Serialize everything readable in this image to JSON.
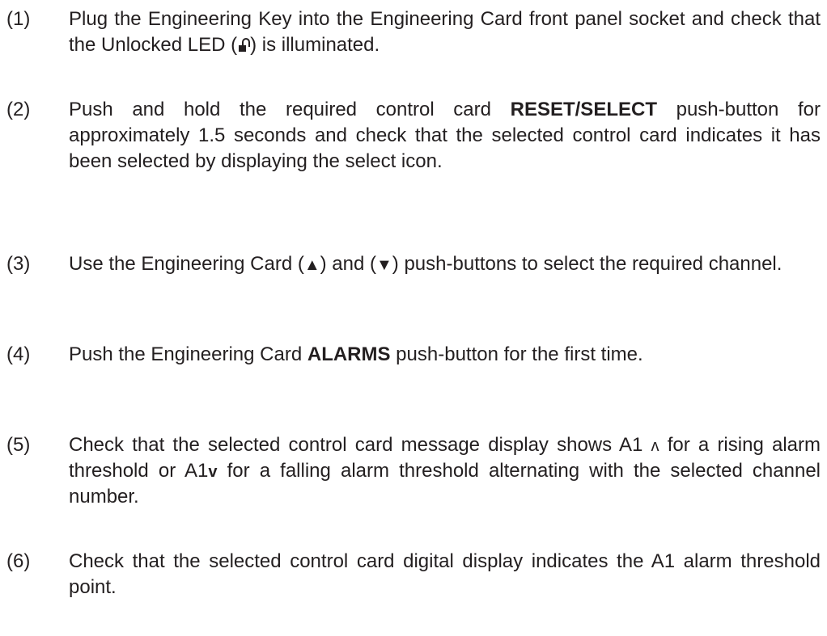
{
  "steps": [
    {
      "number": "(1)",
      "before": "Plug the Engineering Key into the Engineering Card front panel socket and check that the Unlocked LED (",
      "icon": "unlocked-padlock-icon",
      "after": ") is illuminated."
    },
    {
      "number": "(2)",
      "before": "Push and hold the required control card ",
      "bold": "RESET/SELECT",
      "after": " push-button for approximately 1.5 seconds and check that the selected control card indicates it has been selected by displaying the select icon."
    },
    {
      "number": "(3)",
      "before": "Use the Engineering Card (",
      "up": "▲",
      "middle": ") and (",
      "down": "▼",
      "after": ") push-buttons to select the required channel."
    },
    {
      "number": "(4)",
      "before": "Push the Engineering Card ",
      "bold": "ALARMS",
      "after": " push-button for the first time."
    },
    {
      "number": "(5)",
      "before": "Check that the selected control card message display shows A1 ",
      "rising": "ʌ",
      "middle": " for a rising alarm threshold or A1",
      "falling": "v",
      "after": " for a falling alarm threshold alternating with the selected channel number."
    },
    {
      "number": "(6)",
      "before": "Check that the selected control card digital display indicates the A1 alarm threshold point."
    }
  ]
}
